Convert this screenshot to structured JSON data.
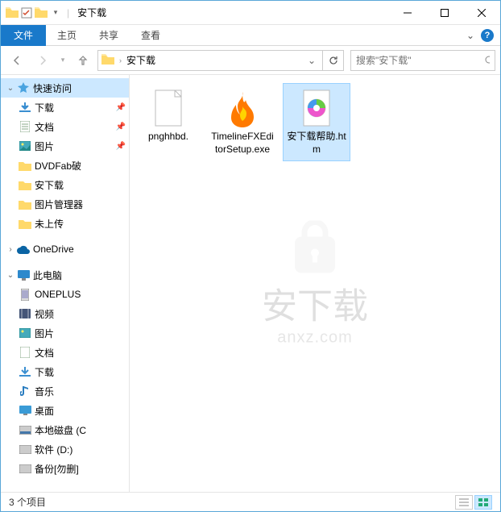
{
  "window": {
    "title": "安下载"
  },
  "ribbon": {
    "file": "文件",
    "home": "主页",
    "share": "共享",
    "view": "查看"
  },
  "address": {
    "path": "安下载"
  },
  "search": {
    "placeholder": "搜索\"安下载\""
  },
  "sidebar": {
    "quick_access": "快速访问",
    "downloads": "下载",
    "documents": "文档",
    "pictures": "图片",
    "dvdfab": "DVDFab破",
    "anxz": "安下载",
    "picmgr": "图片管理器",
    "not_uploaded": "未上传",
    "onedrive": "OneDrive",
    "this_pc": "此电脑",
    "oneplus": "ONEPLUS",
    "videos": "视频",
    "pictures2": "图片",
    "documents2": "文档",
    "downloads2": "下载",
    "music": "音乐",
    "desktop": "桌面",
    "localdisk": "本地磁盘 (C",
    "software": "软件 (D:)",
    "backup": "备份[勿删]"
  },
  "files": [
    {
      "name": "pnghhbd.",
      "type": "blank",
      "selected": false
    },
    {
      "name": "TimelineFXEditorSetup.exe",
      "type": "fire",
      "selected": false
    },
    {
      "name": "安下载帮助.htm",
      "type": "htm",
      "selected": true
    }
  ],
  "watermark": {
    "line1": "安下载",
    "line2": "anxz.com"
  },
  "status": {
    "text": "3 个项目"
  }
}
